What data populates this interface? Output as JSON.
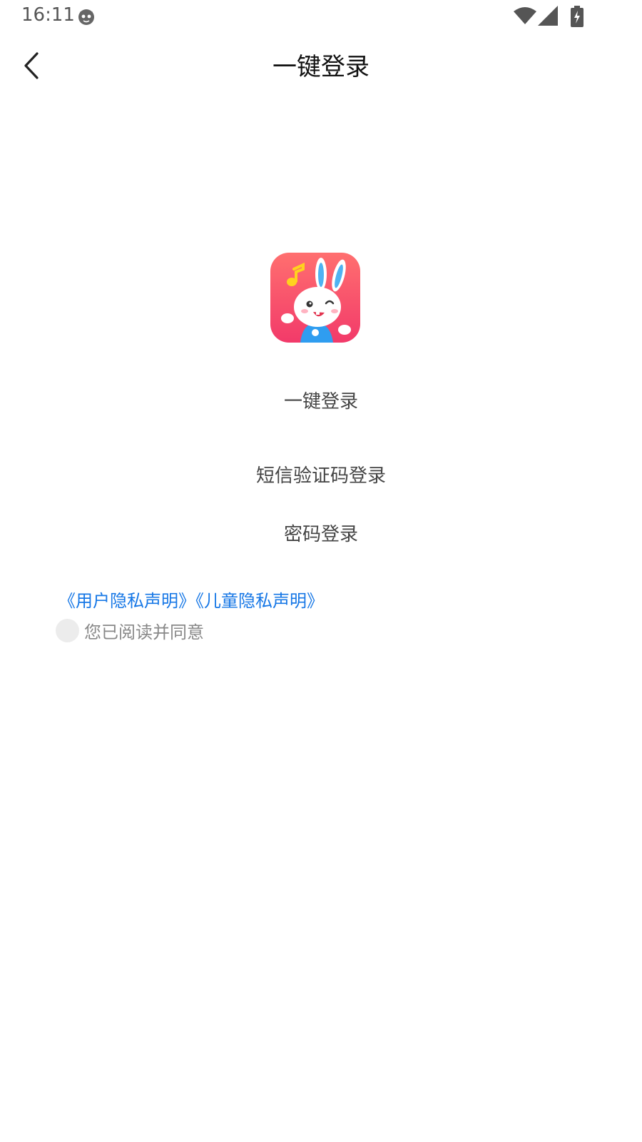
{
  "status": {
    "time": "16:11"
  },
  "header": {
    "title": "一键登录"
  },
  "main": {
    "options": [
      "一键登录",
      "短信验证码登录",
      "密码登录"
    ],
    "policies": [
      "《用户隐私声明》",
      "《儿童隐私声明》"
    ],
    "agree_text": "您已阅读并同意"
  },
  "icons": {
    "back": "chevron-left-icon",
    "status_face": "cat-face-icon",
    "wifi": "wifi-icon",
    "signal": "signal-icon",
    "battery": "battery-charging-icon",
    "app": "bunny-app-icon"
  },
  "colors": {
    "link": "#1677e6",
    "icon_gradient_top": "#ff6f6f",
    "icon_gradient_bottom": "#f23a6a",
    "bunny_shirt": "#2f9df0"
  }
}
